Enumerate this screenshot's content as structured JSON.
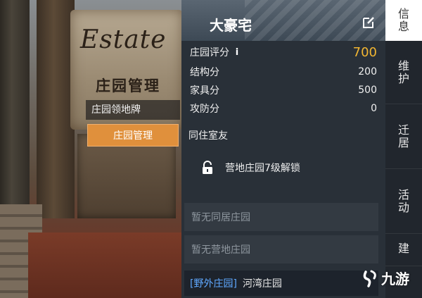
{
  "scene": {
    "sign_script": "Estate",
    "sign_title": "庄园管理",
    "tooltip_label": "庄园领地牌",
    "tooltip_button": "庄园管理"
  },
  "panel": {
    "estate_name": "大豪宅",
    "scores": [
      {
        "label": "庄园评分",
        "value": "700",
        "has_info": true,
        "info_glyph": "i"
      },
      {
        "label": "结构分",
        "value": "200"
      },
      {
        "label": "家具分",
        "value": "500"
      },
      {
        "label": "攻防分",
        "value": "0"
      }
    ],
    "roommates_title": "同住室友",
    "unlock_text": "营地庄园7级解锁",
    "slots": [
      {
        "text": "暂无同居庄园"
      },
      {
        "text": "暂无营地庄园"
      }
    ],
    "wild": {
      "tag": "[野外庄园]",
      "name": "河湾庄园"
    }
  },
  "tabs": [
    {
      "chars": [
        "信",
        "息"
      ],
      "active": true
    },
    {
      "chars": [
        "维",
        "护"
      ],
      "active": false
    },
    {
      "chars": [
        "迁",
        "居"
      ],
      "active": false
    },
    {
      "chars": [
        "活",
        "动"
      ],
      "active": false
    },
    {
      "chars": [
        "建"
      ],
      "active": false
    }
  ],
  "watermark": {
    "text": "九游"
  },
  "colors": {
    "panel_bg": "#28303a",
    "score_highlight": "#f2b632",
    "tooltip_button_bg": "#e0903c",
    "wild_tag": "#5fa8ff",
    "active_tab_bg": "#ffffff"
  },
  "icons": {
    "edit": "edit-icon",
    "lock": "lock-icon",
    "watermark": "jiuyou-logo-icon"
  }
}
